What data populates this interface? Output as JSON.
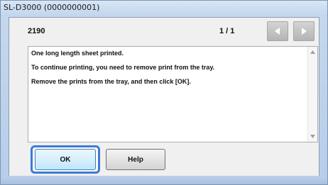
{
  "window": {
    "title": "SL-D3000 (0000000001)"
  },
  "header": {
    "job_id": "2190",
    "page_indicator": "1 / 1",
    "prev_icon": "left-arrow-icon",
    "next_icon": "right-arrow-icon"
  },
  "message": {
    "lines": [
      "One long length sheet printed.",
      "To continue printing, you need to remove print from the tray.",
      "Remove the prints from the tray, and then click [OK]."
    ]
  },
  "buttons": {
    "ok_label": "OK",
    "help_label": "Help"
  },
  "colors": {
    "focus_ring": "#3d7bd6",
    "title_bar": "#c2d5ec"
  }
}
